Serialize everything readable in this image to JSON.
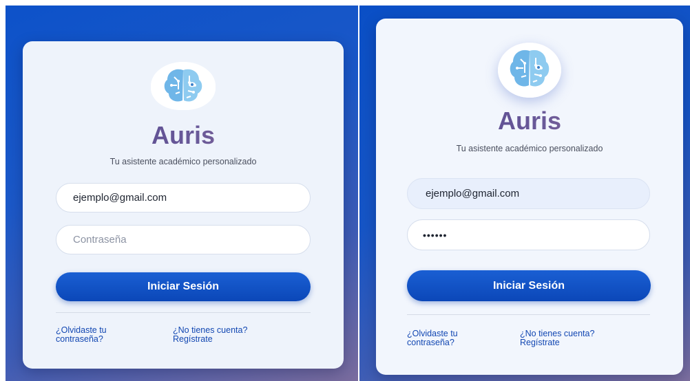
{
  "screens": [
    {
      "brand": "Auris",
      "tagline": "Tu asistente académico personalizado",
      "email_value": "ejemplo@gmail.com",
      "password_placeholder": "Contraseña",
      "password_value": "",
      "login_button": "Iniciar Sesión",
      "forgot_line1": "¿Olvidaste tu",
      "forgot_line2": "contraseña?",
      "signup_line1": "¿No tienes cuenta?",
      "signup_line2": "Regístrate",
      "logo_icon": "brain-circuit-logo-icon"
    },
    {
      "brand": "Auris",
      "tagline": "Tu asistente académico personalizado",
      "email_value": "ejemplo@gmail.com",
      "password_value": "••••••",
      "login_button": "Iniciar Sesión",
      "forgot_line1": "¿Olvidaste tu",
      "forgot_line2": "contraseña?",
      "signup_line1": "¿No tienes cuenta?",
      "signup_line2": "Regístrate",
      "logo_icon": "brain-circuit-logo-icon"
    }
  ],
  "colors": {
    "background_gradient_start": "#0d52c9",
    "background_gradient_end": "#7a6c9e",
    "card": "#eef3fb",
    "button": "#0b47b8",
    "link": "#1247b2",
    "brand_gradient_start": "#4b3f8a",
    "brand_gradient_end": "#b07388"
  }
}
